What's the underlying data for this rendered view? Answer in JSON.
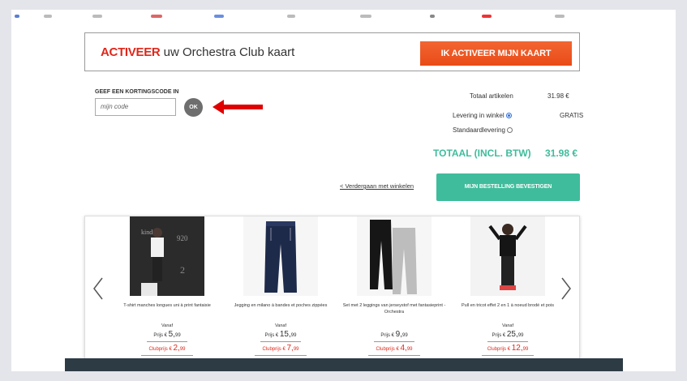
{
  "banner": {
    "highlight": "ACTIVEER",
    "text": " uw Orchestra Club kaart",
    "button_label": "IK ACTIVEER MIJN KAART"
  },
  "discount": {
    "label": "GEEF EEN KORTINGSCODE IN",
    "placeholder": "mijn code",
    "ok_label": "OK"
  },
  "totals": {
    "articles_label": "Totaal artikelen",
    "articles_value": "31.98 €",
    "store_delivery_label": "Levering in winkel",
    "store_delivery_value": "GRATIS",
    "standard_delivery_label": "Standaardlevering",
    "grand_label": "TOTAAL (INCL. BTW)",
    "grand_value": "31.98 €"
  },
  "actions": {
    "continue_label": "< Verdergaan met winkelen",
    "confirm_label": "MIJN BESTELLING BEVESTIGEN"
  },
  "products": [
    {
      "name": "T-shirt manches longues uni à print fantaisie",
      "vanaf": "Vanaf",
      "price_prefix": "Prijs € ",
      "price_main": "5,",
      "price_cents": "99",
      "club_prefix": "Clubprijs € ",
      "club_main": "2,",
      "club_cents": "99"
    },
    {
      "name": "Jegging en milano à bandes et poches zippées",
      "vanaf": "Vanaf",
      "price_prefix": "Prijs € ",
      "price_main": "15,",
      "price_cents": "99",
      "club_prefix": "Clubprijs € ",
      "club_main": "7,",
      "club_cents": "99"
    },
    {
      "name": "Set met 2 leggings van jerseystof met fantasieprint - Orchestra",
      "vanaf": "",
      "price_prefix": "Prijs € ",
      "price_main": "9,",
      "price_cents": "99",
      "club_prefix": "Clubprijs € ",
      "club_main": "4,",
      "club_cents": "99"
    },
    {
      "name": "Pull en tricot effet 2 en 1 à noeud brodé et pois",
      "vanaf": "Vanaf",
      "price_prefix": "Prijs € ",
      "price_main": "25,",
      "price_cents": "99",
      "club_prefix": "Clubprijs € ",
      "club_main": "12,",
      "club_cents": "99"
    }
  ],
  "colors": {
    "accent_orange": "#e94b16",
    "accent_teal": "#3fbc9b",
    "club_red": "#e0271a",
    "arrow_red": "#e00000"
  },
  "icons": {
    "prev": "chevron-left-icon",
    "next": "chevron-right-icon",
    "arrow": "red-arrow-icon"
  }
}
